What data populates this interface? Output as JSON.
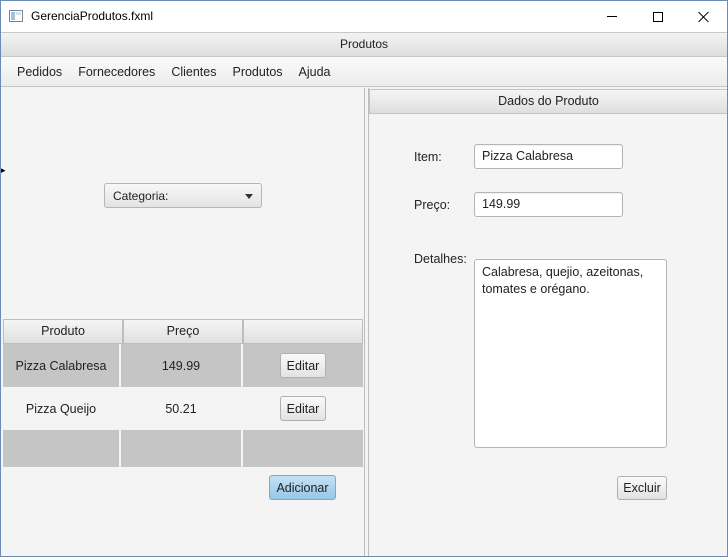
{
  "window": {
    "title": "GerenciaProdutos.fxml",
    "controls": {
      "minimize": "minimize-icon",
      "maximize": "maximize-icon",
      "close": "close-icon"
    }
  },
  "header": {
    "title": "Produtos"
  },
  "menu": {
    "items": [
      {
        "label": "Pedidos"
      },
      {
        "label": "Fornecedores"
      },
      {
        "label": "Clientes"
      },
      {
        "label": "Produtos"
      },
      {
        "label": "Ajuda"
      }
    ]
  },
  "filter": {
    "category_label": "Categoria:"
  },
  "table": {
    "columns": [
      "Produto",
      "Preço",
      ""
    ],
    "rows": [
      {
        "produto": "Pizza Calabresa",
        "preco": "149.99",
        "action": "Editar"
      },
      {
        "produto": "Pizza Queijo",
        "preco": "50.21",
        "action": "Editar"
      }
    ]
  },
  "actions": {
    "add_label": "Adicionar"
  },
  "details": {
    "title": "Dados do Produto",
    "item_label": "Item:",
    "item_value": "Pizza Calabresa",
    "price_label": "Preço:",
    "price_value": "149.99",
    "details_label": "Detalhes:",
    "details_value": "Calabresa, quejio, azeitonas,\ntomates e orégano.",
    "delete_label": "Excluir"
  },
  "colors": {
    "accent_button": "#a9d3ef",
    "selected_row": "#c5c5c5",
    "window_border": "#6b8cb5"
  }
}
